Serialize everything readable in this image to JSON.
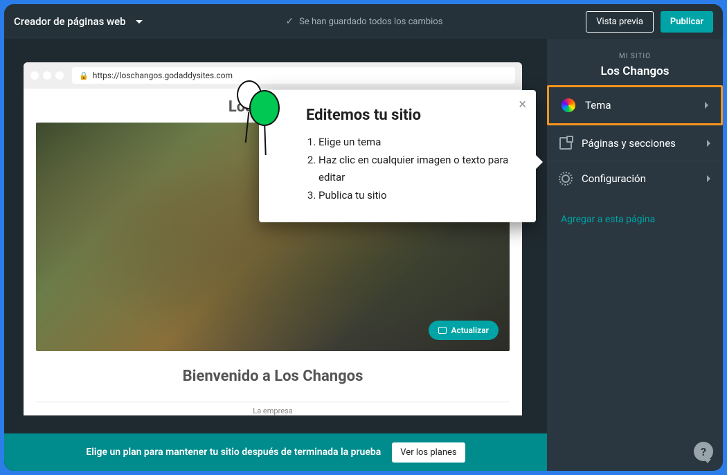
{
  "topbar": {
    "brand": "Creador de páginas web",
    "saved_status": "Se han guardado todos los cambios",
    "preview_button": "Vista previa",
    "publish_button": "Publicar"
  },
  "browser": {
    "url": "https://loschangos.godaddysites.com"
  },
  "site_preview": {
    "title": "Los Changos",
    "update_button": "Actualizar",
    "welcome_heading": "Bienvenido a Los Changos",
    "subsection": "La empresa"
  },
  "popover": {
    "title": "Editemos tu sitio",
    "steps": [
      "Elige un tema",
      "Haz clic en cualquier imagen o texto para editar",
      "Publica tu sitio"
    ]
  },
  "sidebar": {
    "eyebrow": "MI SITIO",
    "site_name": "Los Changos",
    "items": [
      {
        "label": "Tema",
        "icon": "theme",
        "highlight": true
      },
      {
        "label": "Páginas y secciones",
        "icon": "pages",
        "highlight": false
      },
      {
        "label": "Configuración",
        "icon": "gear",
        "highlight": false
      }
    ],
    "add_link": "Agregar a esta página"
  },
  "banner": {
    "text": "Elige un plan para mantener tu sitio después de terminada la prueba",
    "button": "Ver los planes"
  },
  "help_glyph": "?"
}
